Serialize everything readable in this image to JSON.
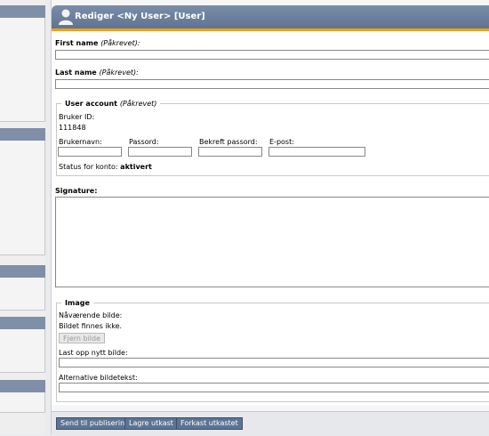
{
  "window": {
    "title": "Rediger <Ny User> [User]"
  },
  "form": {
    "first_name": {
      "label": "First name",
      "required": "(Påkrevet):",
      "value": ""
    },
    "last_name": {
      "label": "Last name",
      "required": "(Påkrevet):",
      "value": ""
    },
    "user_account": {
      "legend": "User account",
      "required": "(Påkrevet)",
      "id_label": "Bruker ID:",
      "id_value": "111848",
      "columns": [
        "Brukernavn:",
        "Passord:",
        "Bekreft passord:",
        "E-post:"
      ],
      "status_label": "Status for konto:",
      "status_value": "aktivert"
    },
    "signature": {
      "label": "Signature:",
      "value": ""
    },
    "image": {
      "legend": "Image",
      "current_label": "Nåværende bilde:",
      "no_image": "Bildet finnes ikke.",
      "remove_button": "Fjern bilde",
      "upload_label": "Last opp nytt bilde:",
      "alt_label": "Alternative bildetekst:"
    }
  },
  "footer": {
    "buttons": [
      "Send til publisering",
      "Lagre utkast",
      "Forkast utkastet"
    ]
  }
}
